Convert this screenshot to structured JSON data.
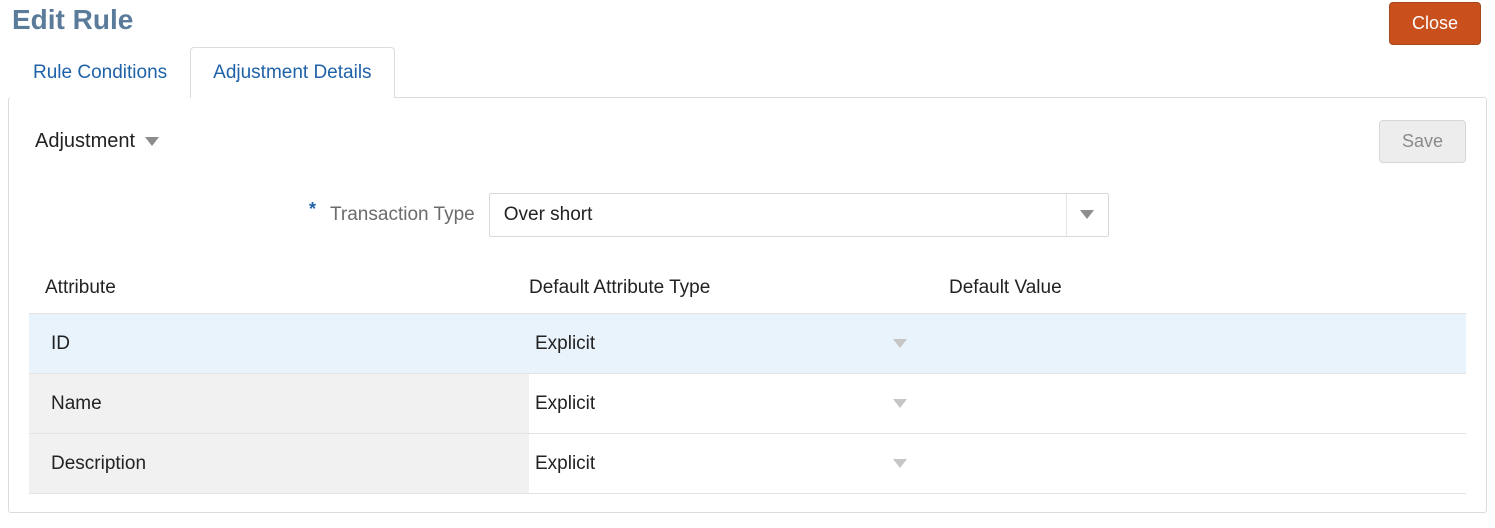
{
  "header": {
    "title": "Edit Rule",
    "close_label": "Close"
  },
  "tabs": {
    "rule_conditions": "Rule Conditions",
    "adjustment_details": "Adjustment Details"
  },
  "panel": {
    "section_title": "Adjustment",
    "save_label": "Save",
    "transaction_type": {
      "star": "*",
      "label": "Transaction Type",
      "value": "Over short"
    },
    "columns": {
      "attribute": "Attribute",
      "default_attr_type": "Default Attribute Type",
      "default_value": "Default Value"
    },
    "rows": [
      {
        "attribute": "ID",
        "type": "Explicit",
        "value": "",
        "selected": true
      },
      {
        "attribute": "Name",
        "type": "Explicit",
        "value": "",
        "selected": false
      },
      {
        "attribute": "Description",
        "type": "Explicit",
        "value": "",
        "selected": false
      }
    ]
  },
  "icons": {
    "chevron_color_dark": "#7a7a7a",
    "chevron_color_light": "#c6c6c6"
  }
}
